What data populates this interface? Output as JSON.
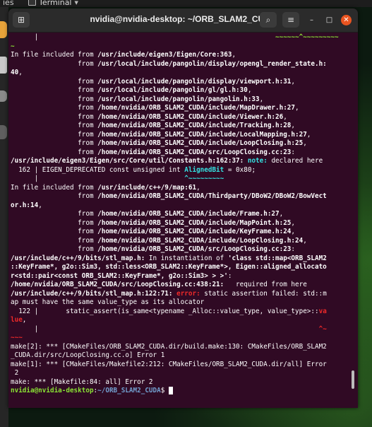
{
  "topbar": {
    "activities": "ies",
    "app_name": "Terminal"
  },
  "window": {
    "title": "nvidia@nvidia-desktop: ~/ORB_SLAM2_CUDA",
    "newtab_icon": "new-tab-icon",
    "search_icon": "search-icon",
    "menu_icon": "hamburger-menu-icon",
    "minimize_glyph": "–",
    "maximize_glyph": "□",
    "close_glyph": "✕",
    "menu_glyph": "≡",
    "search_glyph": "⌕",
    "newtab_glyph": "⊞"
  },
  "lines": [
    [
      {
        "t": "      |                                                            "
      },
      {
        "t": "~~~~~~^~~~~~~~~~",
        "c": "gr"
      }
    ],
    [
      {
        "t": "~",
        "c": "gr"
      }
    ],
    [
      {
        "t": "In file included from "
      },
      {
        "t": "/usr/include/eigen3/Eigen/Core:363",
        "c": "b"
      },
      {
        "t": ","
      }
    ],
    [
      {
        "t": "                 from "
      },
      {
        "t": "/usr/local/include/pangolin/display/opengl_render_state.h:",
        "c": "b"
      }
    ],
    [
      {
        "t": "40",
        "c": "b"
      },
      {
        "t": ","
      }
    ],
    [
      {
        "t": "                 from "
      },
      {
        "t": "/usr/local/include/pangolin/display/viewport.h:31",
        "c": "b"
      },
      {
        "t": ","
      }
    ],
    [
      {
        "t": "                 from "
      },
      {
        "t": "/usr/local/include/pangolin/gl/gl.h:30",
        "c": "b"
      },
      {
        "t": ","
      }
    ],
    [
      {
        "t": "                 from "
      },
      {
        "t": "/usr/local/include/pangolin/pangolin.h:33",
        "c": "b"
      },
      {
        "t": ","
      }
    ],
    [
      {
        "t": "                 from "
      },
      {
        "t": "/home/nvidia/ORB_SLAM2_CUDA/include/MapDrawer.h:27",
        "c": "b"
      },
      {
        "t": ","
      }
    ],
    [
      {
        "t": "                 from "
      },
      {
        "t": "/home/nvidia/ORB_SLAM2_CUDA/include/Viewer.h:26",
        "c": "b"
      },
      {
        "t": ","
      }
    ],
    [
      {
        "t": "                 from "
      },
      {
        "t": "/home/nvidia/ORB_SLAM2_CUDA/include/Tracking.h:28",
        "c": "b"
      },
      {
        "t": ","
      }
    ],
    [
      {
        "t": "                 from "
      },
      {
        "t": "/home/nvidia/ORB_SLAM2_CUDA/include/LocalMapping.h:27",
        "c": "b"
      },
      {
        "t": ","
      }
    ],
    [
      {
        "t": "                 from "
      },
      {
        "t": "/home/nvidia/ORB_SLAM2_CUDA/include/LoopClosing.h:25",
        "c": "b"
      },
      {
        "t": ","
      }
    ],
    [
      {
        "t": "                 from "
      },
      {
        "t": "/home/nvidia/ORB_SLAM2_CUDA/src/LoopClosing.cc:23",
        "c": "b"
      },
      {
        "t": ":"
      }
    ],
    [
      {
        "t": "/usr/include/eigen3/Eigen/src/Core/util/Constants.h:162:37:",
        "c": "b"
      },
      {
        "t": " "
      },
      {
        "t": "note:",
        "c": "cy"
      },
      {
        "t": " declared here"
      }
    ],
    [
      {
        "t": "  162 | EIGEN_DEPRECATED const unsigned int "
      },
      {
        "t": "AlignedBit",
        "c": "cy"
      },
      {
        "t": " = 0x80;"
      }
    ],
    [
      {
        "t": "      |                                     "
      },
      {
        "t": "^~~~~~~~~~",
        "c": "cy"
      }
    ],
    [
      {
        "t": "In file included from "
      },
      {
        "t": "/usr/include/c++/9/map:61",
        "c": "b"
      },
      {
        "t": ","
      }
    ],
    [
      {
        "t": "                 from "
      },
      {
        "t": "/home/nvidia/ORB_SLAM2_CUDA/Thirdparty/DBoW2/DBoW2/BowVect",
        "c": "b"
      }
    ],
    [
      {
        "t": "or.h:14",
        "c": "b"
      },
      {
        "t": ","
      }
    ],
    [
      {
        "t": "                 from "
      },
      {
        "t": "/home/nvidia/ORB_SLAM2_CUDA/include/Frame.h:27",
        "c": "b"
      },
      {
        "t": ","
      }
    ],
    [
      {
        "t": "                 from "
      },
      {
        "t": "/home/nvidia/ORB_SLAM2_CUDA/include/MapPoint.h:25",
        "c": "b"
      },
      {
        "t": ","
      }
    ],
    [
      {
        "t": "                 from "
      },
      {
        "t": "/home/nvidia/ORB_SLAM2_CUDA/include/KeyFrame.h:24",
        "c": "b"
      },
      {
        "t": ","
      }
    ],
    [
      {
        "t": "                 from "
      },
      {
        "t": "/home/nvidia/ORB_SLAM2_CUDA/include/LoopClosing.h:24",
        "c": "b"
      },
      {
        "t": ","
      }
    ],
    [
      {
        "t": "                 from "
      },
      {
        "t": "/home/nvidia/ORB_SLAM2_CUDA/src/LoopClosing.cc:23",
        "c": "b"
      },
      {
        "t": ":"
      }
    ],
    [
      {
        "t": "/usr/include/c++/9/bits/stl_map.h:",
        "c": "b"
      },
      {
        "t": " In instantiation of "
      },
      {
        "t": "'class std::map<ORB_SLAM2",
        "c": "b"
      }
    ],
    [
      {
        "t": "::KeyFrame*, g2o::Sim3, std::less<ORB_SLAM2::KeyFrame*>, Eigen::aligned_allocato",
        "c": "b"
      }
    ],
    [
      {
        "t": "r<std::pair<const ORB_SLAM2::KeyFrame*, g2o::Sim3> > >'",
        "c": "b"
      },
      {
        "t": ":"
      }
    ],
    [
      {
        "t": "/home/nvidia/ORB_SLAM2_CUDA/src/LoopClosing.cc:438:21:",
        "c": "b"
      },
      {
        "t": "   required from here"
      }
    ],
    [
      {
        "t": "/usr/include/c++/9/bits/stl_map.h:122:71:",
        "c": "b"
      },
      {
        "t": " "
      },
      {
        "t": "error:",
        "c": "rd"
      },
      {
        "t": " static assertion failed: std::m"
      }
    ],
    [
      {
        "t": "ap must have the same value_type as its allocator"
      }
    ],
    [
      {
        "t": "  122 |       static_assert(is_same<typename _Alloc::value_type, value_type>::"
      },
      {
        "t": "va",
        "c": "rd"
      }
    ],
    [
      {
        "t": "lue",
        "c": "rd"
      },
      {
        "t": ","
      }
    ],
    [
      {
        "t": "      |                                                                       "
      },
      {
        "t": "^~",
        "c": "rd"
      }
    ],
    [
      {
        "t": "~~~",
        "c": "rd"
      }
    ],
    [
      {
        "t": "make[2]: *** [CMakeFiles/ORB_SLAM2_CUDA.dir/build.make:130: CMakeFiles/ORB_SLAM2"
      }
    ],
    [
      {
        "t": "_CUDA.dir/src/LoopClosing.cc.o] Error 1"
      }
    ],
    [
      {
        "t": "make[1]: *** [CMakeFiles/Makefile2:212: CMakeFiles/ORB_SLAM2_CUDA.dir/all] Error"
      }
    ],
    [
      {
        "t": " 2"
      }
    ],
    [
      {
        "t": "make: *** [Makefile:84: all] Error 2"
      }
    ]
  ],
  "prompt": {
    "user_host": "nvidia@nvidia-desktop",
    "sep": ":",
    "path": "~/ORB_SLAM2_CUDA",
    "symbol": "$ "
  }
}
